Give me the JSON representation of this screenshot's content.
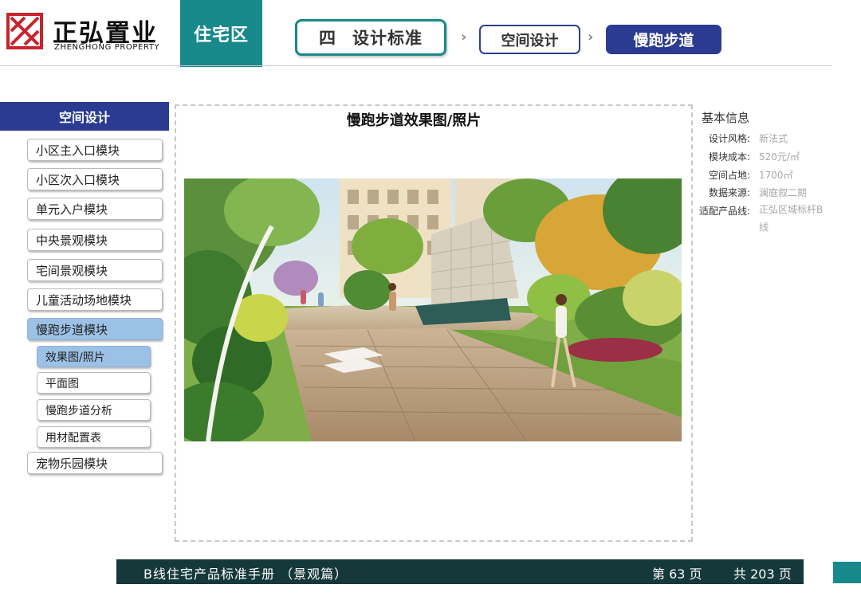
{
  "logo": {
    "cn": "正弘置业",
    "en": "ZHENGHONG PROPERTY",
    "icon": "zhenghong-logo-mark",
    "color": "#c8232c"
  },
  "header": {
    "section_tab": "住宅区",
    "breadcrumb": {
      "chapter_num": "四",
      "chapter": "设计标准",
      "level2": "空间设计",
      "level3": "慢跑步道",
      "separator": "›"
    }
  },
  "sidebar": {
    "header": "空间设计",
    "items": [
      {
        "label": "小区主入口模块"
      },
      {
        "label": "小区次入口模块"
      },
      {
        "label": "单元入户模块"
      },
      {
        "label": "中央景观模块"
      },
      {
        "label": "宅间景观模块"
      },
      {
        "label": "儿童活动场地模块"
      },
      {
        "label": "慢跑步道模块",
        "active": true
      },
      {
        "label": "宠物乐园模块"
      }
    ],
    "subitems": [
      {
        "label": "效果图/照片",
        "active": true
      },
      {
        "label": "平面图"
      },
      {
        "label": "慢跑步道分析"
      },
      {
        "label": "用材配置表"
      }
    ]
  },
  "main": {
    "title": "慢跑步道效果图/照片",
    "image": "jogging-trail-rendering"
  },
  "info": {
    "title": "基本信息",
    "rows": [
      {
        "key": "设计风格:",
        "value": "新法式"
      },
      {
        "key": "模块成本:",
        "value": "520元/㎡"
      },
      {
        "key": "空间占地:",
        "value": "1700㎡"
      },
      {
        "key": "数据来源:",
        "value": "澜庭叙二期"
      },
      {
        "key": "适配产品线:",
        "value": "正弘区域标杆B线"
      }
    ]
  },
  "footer": {
    "title": "B线住宅产品标准手册 （景观篇）",
    "page": "第 63 页",
    "total": "共 203 页"
  },
  "colors": {
    "teal": "#17898a",
    "navy": "#2b3b91",
    "active_blue": "#9cc1e6",
    "footer_bg": "#15383b"
  }
}
